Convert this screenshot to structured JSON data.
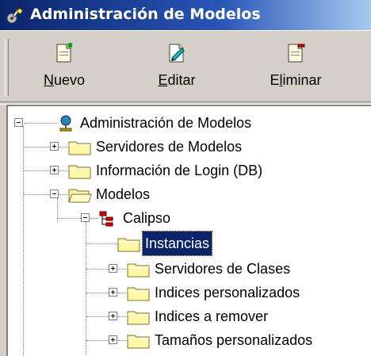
{
  "window": {
    "title": "Administración de Modelos"
  },
  "toolbar": {
    "buttons": [
      {
        "pre": "",
        "key": "N",
        "post": "uevo",
        "icon": "new-document-icon"
      },
      {
        "pre": "",
        "key": "E",
        "post": "ditar",
        "icon": "edit-document-icon"
      },
      {
        "pre": "E",
        "key": "l",
        "post": "iminar",
        "icon": "delete-document-icon"
      }
    ]
  },
  "tree": {
    "root": "Administración de Modelos",
    "items": [
      {
        "label": "Servidores de Modelos",
        "state": "collapsed"
      },
      {
        "label": "Información de Login (DB)",
        "state": "collapsed"
      },
      {
        "label": "Modelos",
        "state": "expanded"
      },
      {
        "label": "Calipso",
        "state": "expanded"
      },
      {
        "label": "Instancias",
        "state": "leaf",
        "selected": true
      },
      {
        "label": "Servidores de Clases",
        "state": "collapsed"
      },
      {
        "label": "Indices personalizados",
        "state": "collapsed"
      },
      {
        "label": "Indices a remover",
        "state": "collapsed"
      },
      {
        "label": "Tamaños personalizados",
        "state": "collapsed"
      }
    ]
  },
  "colors": {
    "titlebar": "#0a246a",
    "selection": "#0a246a",
    "face": "#d4d0c8"
  }
}
